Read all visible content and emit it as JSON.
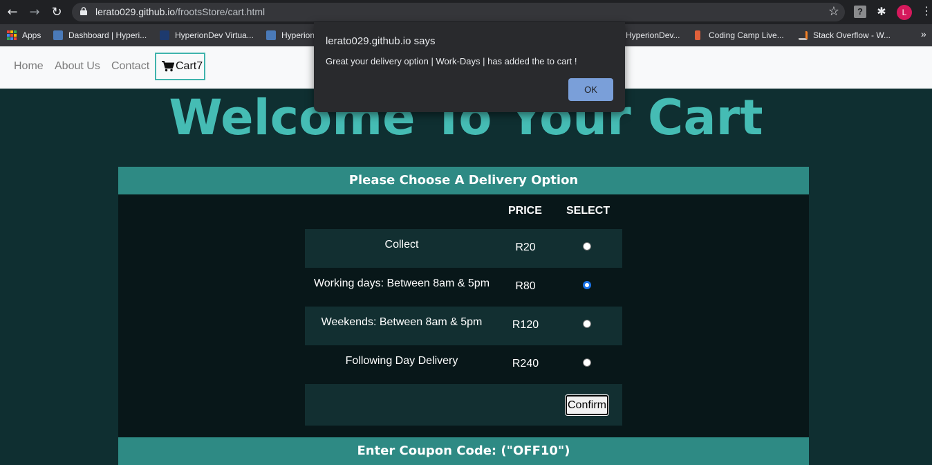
{
  "browser": {
    "url_host": "lerato029.github.io",
    "url_path": "/frootsStore/cart.html",
    "avatar_letter": "L",
    "bookmarks": [
      {
        "label": "Apps",
        "icon": "apps-grid-icon"
      },
      {
        "label": "Dashboard | Hyperi...",
        "icon": "hyperion-icon"
      },
      {
        "label": "HyperionDev Virtua...",
        "icon": "hyperion-dark-icon"
      },
      {
        "label": "Hyperion",
        "icon": "hyperion-icon"
      },
      {
        "label": "HyperionDev...",
        "icon": ""
      },
      {
        "label": "Coding Camp Live...",
        "icon": "codingcamp-icon"
      },
      {
        "label": "Stack Overflow - W...",
        "icon": "stackoverflow-icon"
      }
    ],
    "more_bookmarks": "»"
  },
  "navbar": {
    "links": [
      "Home",
      "About Us",
      "Contact"
    ],
    "cart_label": "Cart7"
  },
  "page": {
    "heading": "Welcome To Your Cart",
    "delivery_heading": "Please Choose A Delivery Option",
    "col_price": "PRICE",
    "col_select": "SELECT",
    "options": [
      {
        "label": "Collect",
        "price": "R20",
        "selected": false
      },
      {
        "label": "Working days: Between 8am & 5pm",
        "price": "R80",
        "selected": true
      },
      {
        "label": "Weekends: Between 8am & 5pm",
        "price": "R120",
        "selected": false
      },
      {
        "label": "Following Day Delivery",
        "price": "R240",
        "selected": false
      }
    ],
    "confirm_label": "Confirm",
    "coupon_heading": "Enter Coupon Code: (\"OFF10\")"
  },
  "dialog": {
    "title": "lerato029.github.io says",
    "message": "Great your delivery option | Work-Days | has added the to cart !",
    "ok_label": "OK"
  },
  "colors": {
    "page_bg": "#0f2f31",
    "accent": "#45bcb4",
    "panel_head": "#2e8a84",
    "dialog_bg": "#292a2d",
    "ok_button": "#7a9fd9"
  }
}
